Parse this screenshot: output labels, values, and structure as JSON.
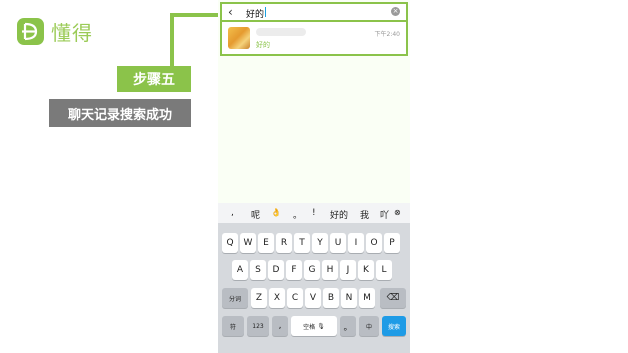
{
  "brand": {
    "name": "懂得",
    "logo_icon": "dongde-logo-icon",
    "color": "#8bc34a"
  },
  "annotation": {
    "step": "步骤五",
    "caption": "聊天记录搜索成功"
  },
  "search": {
    "query": "好的"
  },
  "result": {
    "time": "下午2:40",
    "message": "好的"
  },
  "keyboard": {
    "candidates": [
      ",",
      "呢",
      "👌",
      "。",
      "!",
      "好的",
      "我",
      "吖"
    ],
    "row1": [
      "Q",
      "W",
      "E",
      "R",
      "T",
      "Y",
      "U",
      "I",
      "O",
      "P"
    ],
    "row2": [
      "A",
      "S",
      "D",
      "F",
      "G",
      "H",
      "J",
      "K",
      "L"
    ],
    "row3": [
      "Z",
      "X",
      "C",
      "V",
      "B",
      "N",
      "M"
    ],
    "fenci": "分词",
    "fu": "符",
    "num": "123",
    "comma": ",",
    "space": "空格",
    "period": "。",
    "zhong": "中",
    "search_key": "搜索"
  }
}
